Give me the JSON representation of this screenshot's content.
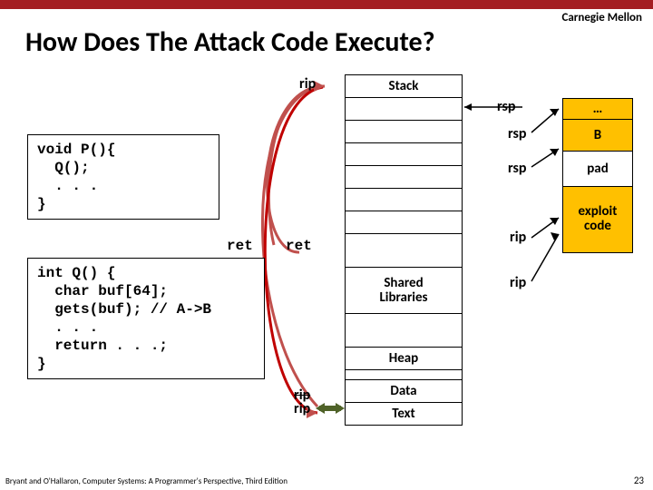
{
  "brand": "Carnegie Mellon",
  "title": "How Does The Attack Code Execute?",
  "codeP": "void P(){\n  Q();\n  . . .\n}",
  "codeQ": "int Q() {\n  char buf[64];\n  gets(buf); // A->B\n  . . .\n  return . . .;\n}",
  "mem": {
    "stack": "Stack",
    "shared": "Shared\nLibraries",
    "heap": "Heap",
    "data": "Data",
    "text": "Text"
  },
  "right": {
    "dots": "…",
    "B": "B",
    "pad": "pad",
    "exploit": "exploit\ncode"
  },
  "pointers": {
    "rip": "rip",
    "rsp": "rsp",
    "ret": "ret"
  },
  "footer": "Bryant and O'Hallaron, Computer Systems: A Programmer's Perspective, Third Edition",
  "pagenum": "23"
}
